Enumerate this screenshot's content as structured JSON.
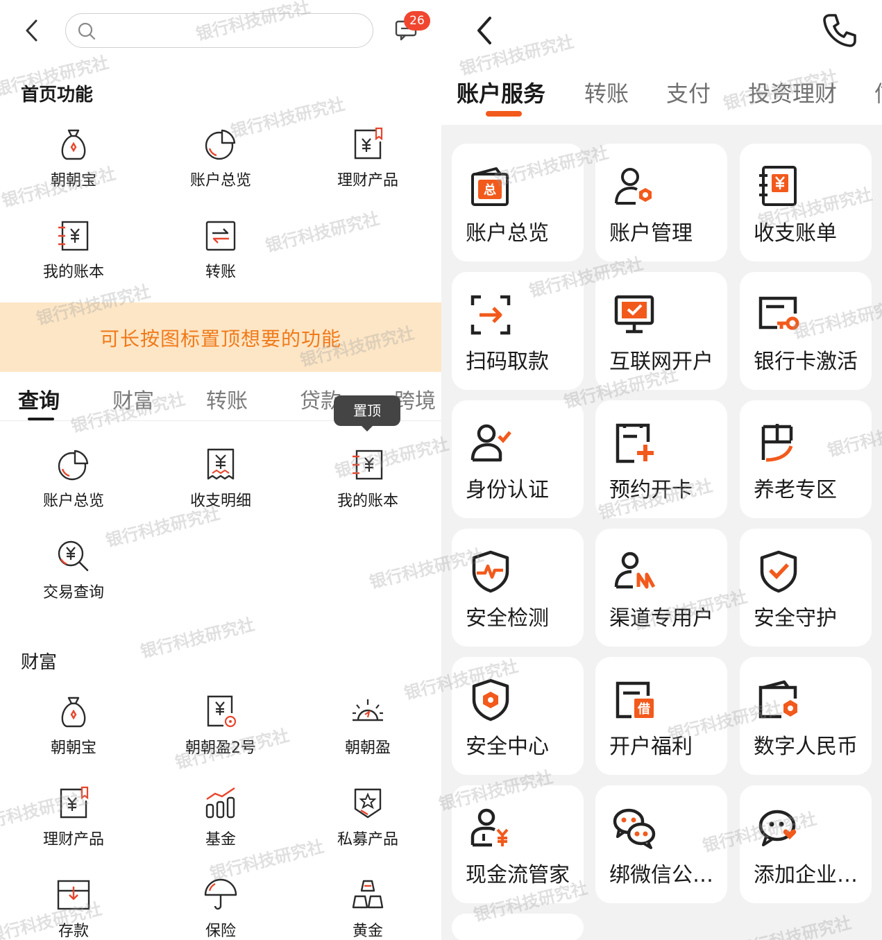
{
  "left": {
    "search": {
      "placeholder": ""
    },
    "message_badge": "26",
    "home_title": "首页功能",
    "home_items": [
      {
        "label": "朝朝宝",
        "icon": "money-bag-icon"
      },
      {
        "label": "账户总览",
        "icon": "pie-chart-icon"
      },
      {
        "label": "理财产品",
        "icon": "finance-doc-icon"
      },
      {
        "label": "我的账本",
        "icon": "ledger-icon"
      },
      {
        "label": "转账",
        "icon": "transfer-icon"
      }
    ],
    "banner": "可长按图标置顶想要的功能",
    "tabs": [
      "查询",
      "财富",
      "转账",
      "贷款",
      "跨境"
    ],
    "active_tab": "查询",
    "query_items": [
      {
        "label": "账户总览",
        "icon": "pie-chart-icon"
      },
      {
        "label": "收支明细",
        "icon": "receipt-icon"
      },
      {
        "label": "我的账本",
        "icon": "ledger-icon"
      },
      {
        "label": "交易查询",
        "icon": "search-yen-icon"
      }
    ],
    "tooltip": "置顶",
    "wealth_title": "财富",
    "wealth_items": [
      {
        "label": "朝朝宝",
        "icon": "money-bag-icon"
      },
      {
        "label": "朝朝盈2号",
        "icon": "yen-doc-icon"
      },
      {
        "label": "朝朝盈",
        "icon": "sunrise-icon"
      },
      {
        "label": "理财产品",
        "icon": "finance-doc-icon"
      },
      {
        "label": "基金",
        "icon": "bar-trend-icon"
      },
      {
        "label": "私募产品",
        "icon": "shield-star-icon"
      },
      {
        "label": "存款",
        "icon": "deposit-box-icon"
      },
      {
        "label": "保险",
        "icon": "umbrella-icon"
      },
      {
        "label": "黄金",
        "icon": "gold-bars-icon"
      }
    ]
  },
  "right": {
    "tabs": [
      "账户服务",
      "转账",
      "支付",
      "投资理财",
      "信"
    ],
    "active_tab": "账户服务",
    "cards": [
      {
        "label": "账户总览",
        "icon": "wallet-total-icon"
      },
      {
        "label": "账户管理",
        "icon": "user-gear-icon"
      },
      {
        "label": "收支账单",
        "icon": "bill-book-icon"
      },
      {
        "label": "扫码取款",
        "icon": "scan-withdraw-icon"
      },
      {
        "label": "互联网开户",
        "icon": "monitor-check-icon"
      },
      {
        "label": "银行卡激活",
        "icon": "card-key-icon"
      },
      {
        "label": "身份认证",
        "icon": "user-check-icon"
      },
      {
        "label": "预约开卡",
        "icon": "card-plus-icon"
      },
      {
        "label": "养老专区",
        "icon": "elder-icon"
      },
      {
        "label": "安全检测",
        "icon": "shield-pulse-icon"
      },
      {
        "label": "渠道专用户",
        "icon": "user-channel-icon"
      },
      {
        "label": "安全守护",
        "icon": "shield-check-icon"
      },
      {
        "label": "安全中心",
        "icon": "shield-hex-icon"
      },
      {
        "label": "开户福利",
        "icon": "gift-card-icon"
      },
      {
        "label": "数字人民币",
        "icon": "digital-wallet-icon"
      },
      {
        "label": "现金流管家",
        "icon": "user-yen-icon"
      },
      {
        "label": "绑微信公…",
        "icon": "wechat-icon"
      },
      {
        "label": "添加企业…",
        "icon": "chat-heart-icon"
      }
    ]
  },
  "watermark": "银行科技研究社",
  "colors": {
    "accent": "#f25a1c",
    "banner_bg": "#fde6c6",
    "banner_text": "#f07a1a",
    "badge": "#f04630",
    "icon_dark": "#2b2b2b",
    "icon_accent": "#e8452c"
  }
}
